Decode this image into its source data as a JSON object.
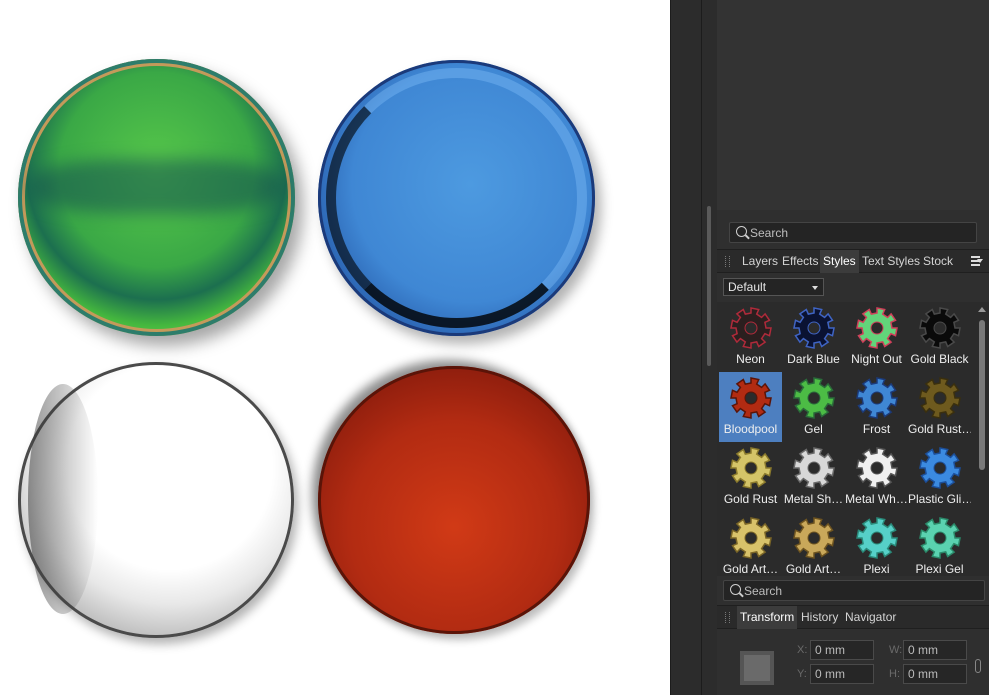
{
  "canvas": {
    "circles": [
      "green-gel",
      "blue-frost",
      "white-metal",
      "red-bloodpool"
    ]
  },
  "top_search": {
    "placeholder": "Search"
  },
  "panel_tabs": {
    "items": [
      "Layers",
      "Effects",
      "Styles",
      "Text Styles",
      "Stock"
    ],
    "active": "Styles"
  },
  "styles": {
    "category": "Default",
    "items": [
      {
        "label": "Neon",
        "color": "#2b1f1f",
        "rim": "#b02a3a",
        "selected": false
      },
      {
        "label": "Dark Blue",
        "color": "#0a1232",
        "rim": "#3f64c4",
        "selected": false
      },
      {
        "label": "Night Out",
        "color": "#62d47a",
        "rim": "#d0405a",
        "selected": false
      },
      {
        "label": "Gold Black",
        "color": "#0a0a0a",
        "rim": "#4a4a4a",
        "selected": false
      },
      {
        "label": "Bloodpool",
        "color": "#b22b12",
        "rim": "#5a1408",
        "selected": true
      },
      {
        "label": "Gel",
        "color": "#4cbc45",
        "rim": "#2a6b3a",
        "selected": false
      },
      {
        "label": "Frost",
        "color": "#3f87d4",
        "rim": "#1b3a7a",
        "selected": false
      },
      {
        "label": "Gold Rust…",
        "color": "#6e5a1e",
        "rim": "#3a2f0e",
        "selected": false
      },
      {
        "label": "Gold Rust",
        "color": "#d4c468",
        "rim": "#8b7a2c",
        "selected": false
      },
      {
        "label": "Metal Sh…",
        "color": "#d8d8d8",
        "rim": "#6a6a6a",
        "selected": false
      },
      {
        "label": "Metal Wh…",
        "color": "#f0f0f0",
        "rim": "#555555",
        "selected": false
      },
      {
        "label": "Plastic Gli…",
        "color": "#3b8ae0",
        "rim": "#1c4f9a",
        "selected": false
      },
      {
        "label": "Gold Art…",
        "color": "#d8c26a",
        "rim": "#7a6526",
        "selected": false
      },
      {
        "label": "Gold Art…",
        "color": "#c9a85a",
        "rim": "#6e5420",
        "selected": false
      },
      {
        "label": "Plexi",
        "color": "#56d0c8",
        "rim": "#2a8a7a",
        "selected": false
      },
      {
        "label": "Plexi Gel",
        "color": "#5ad2b0",
        "rim": "#2b8a6a",
        "selected": false
      }
    ]
  },
  "bottom_search": {
    "placeholder": "Search"
  },
  "transform_tabs": {
    "items": [
      "Transform",
      "History",
      "Navigator"
    ],
    "active": "Transform"
  },
  "transform": {
    "x_label": "X:",
    "x_value": "0 mm",
    "w_label": "W:",
    "w_value": "0 mm",
    "y_label": "Y:",
    "y_value": "0 mm",
    "h_label": "H:",
    "h_value": "0 mm"
  }
}
